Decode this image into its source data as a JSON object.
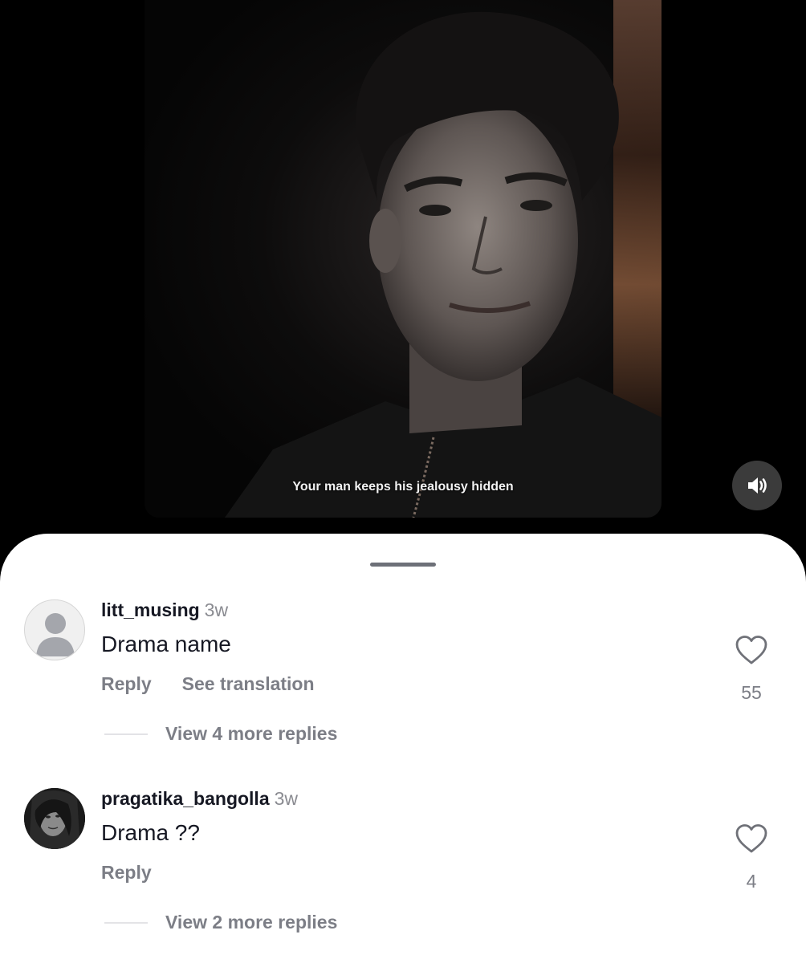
{
  "video": {
    "caption": "Your man keeps his jealousy hidden",
    "sound_icon": "speaker-volume-icon"
  },
  "comments": [
    {
      "username": "litt_musing",
      "time": "3w",
      "text": "Drama name",
      "reply_label": "Reply",
      "translate_label": "See translation",
      "view_more": "View 4 more replies",
      "likes": "55",
      "avatar": "default-user-avatar"
    },
    {
      "username": "pragatika_bangolla",
      "time": "3w",
      "text": "Drama ??",
      "reply_label": "Reply",
      "view_more": "View 2 more replies",
      "likes": "4",
      "avatar": "user-photo-avatar"
    }
  ],
  "colors": {
    "sheet_background": "#ffffff",
    "primary_text": "#161823",
    "secondary_text": "#7c7e86"
  }
}
